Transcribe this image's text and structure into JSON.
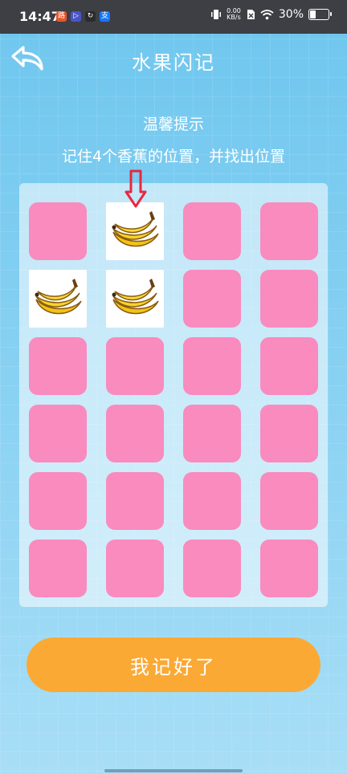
{
  "status_bar": {
    "time": "14:47",
    "app_icons": [
      {
        "name": "app-red-icon",
        "glyph": "路",
        "color": "#e8542c"
      },
      {
        "name": "app-play-icon",
        "glyph": "▷",
        "color": "#4b55c8"
      },
      {
        "name": "app-loop-icon",
        "glyph": "↻",
        "color": "#2b2b2b"
      },
      {
        "name": "alipay-icon",
        "glyph": "支",
        "color": "#1677ff"
      }
    ],
    "net_speed_value": "0.00",
    "net_speed_unit": "KB/s",
    "battery": "30%",
    "battery_level": 0.3
  },
  "header": {
    "title": "水果闪记"
  },
  "tip": {
    "title": "温馨提示",
    "text": "记住4个香蕉的位置，并找出位置"
  },
  "grid": {
    "rows": 6,
    "cols": 4,
    "card_color": "#f98bbe",
    "revealed_fruit": "banana",
    "revealed": [
      [
        0,
        1
      ],
      [
        1,
        0
      ],
      [
        1,
        1
      ]
    ],
    "marked_cell": [
      0,
      1
    ]
  },
  "confirm_button": {
    "label": "我记好了",
    "color": "#fba935"
  }
}
